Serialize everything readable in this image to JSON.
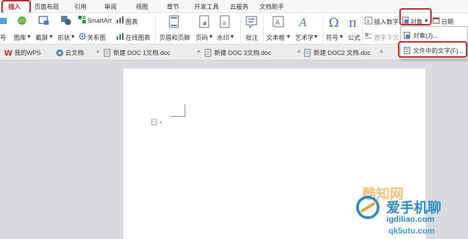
{
  "menubar": {
    "items": [
      "插入",
      "页面布局",
      "引用",
      "审阅",
      "视图",
      "章节",
      "开发工具",
      "云服务",
      "文档助手"
    ]
  },
  "ribbon": {
    "row1": {
      "smartart": "SmartArt",
      "chart": "图表",
      "insert_number": "插入数字",
      "object": "对象",
      "date": "日期"
    },
    "row2": {
      "partial_left": "号",
      "picture_lib": "图库",
      "screenshot": "截屏",
      "shapes": "形状",
      "relation_chart": "关系图",
      "online_chart": "在线图表",
      "header_footer": "页眉和页脚",
      "page_number": "页码",
      "watermark": "水印",
      "comment": "批注",
      "textbox": "文本框",
      "wordart": "艺术字",
      "symbol": "符号",
      "formula": "公式",
      "first_char_sink": "首字下沉"
    }
  },
  "dropdown": {
    "items": [
      "对象(J)...",
      "文件中的文字(F)..."
    ]
  },
  "tabs": [
    {
      "label": "我的WPS",
      "closable": false
    },
    {
      "label": "云文档",
      "closable": true
    },
    {
      "label": "新建 DOC 1文档.doc",
      "closable": true
    },
    {
      "label": "新建 DOC 3文档.doc",
      "closable": true
    },
    {
      "label": "新建 DOC2 文档.doc",
      "closable": true
    }
  ],
  "watermark": {
    "line1": "酷知网",
    "line2": "爱手机聊",
    "line3": "igdiliao.com",
    "line4": "qk5utu.com"
  },
  "colors": {
    "highlight_red": "#d11f1f",
    "wps_red": "#c9302c",
    "page_bg": "#d9dbe0",
    "ribbon_bg": "#ffffff"
  }
}
